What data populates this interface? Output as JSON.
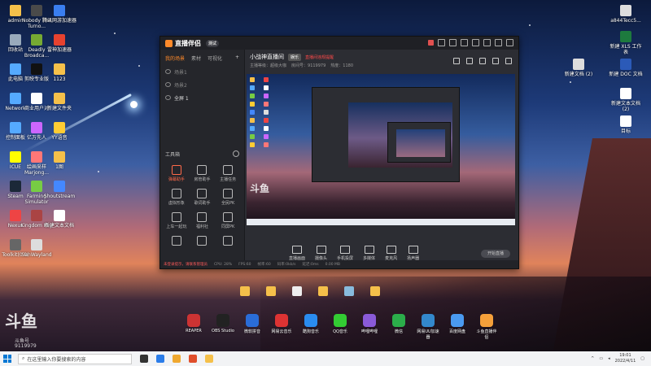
{
  "colors": {
    "accent": "#ff8a2a",
    "warning": "#ff4a4a"
  },
  "desktop": {
    "left_icons": [
      {
        "label": "admin",
        "color": "#f5c04a"
      },
      {
        "label": "Nobody The Turno...",
        "color": "#4a4a4a"
      },
      {
        "label": "腾讯网游加速器",
        "color": "#3a7ef0"
      },
      {
        "label": "回收站",
        "color": "#9ab"
      },
      {
        "label": "Deadly Broadca...",
        "color": "#7a3"
      },
      {
        "label": "雷神加速器",
        "color": "#e7422f"
      },
      {
        "label": "此电脑",
        "color": "#5af"
      },
      {
        "label": "剪映专业版",
        "color": "#111"
      },
      {
        "label": "1123",
        "color": "#f5c04a"
      },
      {
        "label": "Network",
        "color": "#5af"
      },
      {
        "label": "商业用户对",
        "color": "#fff"
      },
      {
        "label": "新建文件夹",
        "color": "#f5c04a"
      },
      {
        "label": "控制面板",
        "color": "#5af"
      },
      {
        "label": "亿万先人",
        "color": "#c6f"
      },
      {
        "label": "YY语音",
        "color": "#fc3"
      },
      {
        "label": "ICUE",
        "color": "#ff0"
      },
      {
        "label": "绘画采样 Marjong...",
        "color": "#f77"
      },
      {
        "label": "1图",
        "color": "#f5c04a"
      },
      {
        "label": "Steam",
        "color": "#1b2838"
      },
      {
        "label": "Farming Simulator",
        "color": "#7c4"
      },
      {
        "label": "Shoutstream",
        "color": "#48f"
      },
      {
        "label": "Nexus",
        "color": "#e44"
      },
      {
        "label": "Kingdom Key",
        "color": "#a44"
      },
      {
        "label": "新建文本文档",
        "color": "#fff"
      },
      {
        "label": "Toolkit(0.9)",
        "color": "#666"
      },
      {
        "label": "SunWayland",
        "color": "#ddd"
      }
    ],
    "right_icons": [
      {
        "label": "a844Tecc5...",
        "color": "#ddd"
      },
      {
        "label": "新建 XLS 工作表",
        "color": "#1d7a3e"
      },
      {
        "label": "新建文档 (2)",
        "color": "#ddd"
      },
      {
        "label": "新建 DOC 文档",
        "color": "#2b5ab8"
      },
      {
        "label": "新建文本文档 (2)",
        "color": "#fff"
      },
      {
        "label": "目标",
        "color": "#fff"
      }
    ],
    "dock": [
      {
        "label": "REAPER",
        "color": "#c33"
      },
      {
        "label": "OBS Studio",
        "color": "#222"
      },
      {
        "label": "微软拼音",
        "color": "#2a6dd8"
      },
      {
        "label": "网易云音乐",
        "color": "#d33"
      },
      {
        "label": "酷狗音乐",
        "color": "#2a8cf0"
      },
      {
        "label": "QQ音乐",
        "color": "#3c3"
      },
      {
        "label": "哔哩哔哩",
        "color": "#8a5ad8"
      },
      {
        "label": "微信",
        "color": "#2bad4a"
      },
      {
        "label": "网易UU加速器",
        "color": "#38c"
      },
      {
        "label": "百度网盘",
        "color": "#4a9af0"
      },
      {
        "label": "斗鱼直播伴侣",
        "color": "#f5a03a"
      }
    ],
    "float_icons": [
      {
        "label": "",
        "color": "#f5c04a"
      },
      {
        "label": "",
        "color": "#f5c04a"
      },
      {
        "label": "",
        "color": "#eee"
      },
      {
        "label": "",
        "color": "#f5c04a"
      },
      {
        "label": "",
        "color": "#8bd"
      },
      {
        "label": "",
        "color": "#f5c04a"
      }
    ],
    "watermark": {
      "title": "斗鱼",
      "sub": "斗鱼号",
      "number": "9119979"
    }
  },
  "window": {
    "app_name": "直播伴侣",
    "version_badge": "测试",
    "title_controls": [
      "avatar",
      "gift-icon",
      "shield-icon",
      "bell-icon",
      "settings-icon",
      "minimize-icon",
      "maximize-icon",
      "close-icon"
    ],
    "left_tabs": [
      "我的场景",
      "素材",
      "可视化"
    ],
    "scenes": [
      {
        "label": "场景1"
      },
      {
        "label": "场景2"
      },
      {
        "label": "全屏 1"
      }
    ],
    "tools_header": "工具箱",
    "tools": [
      {
        "label": "弹幕助手",
        "red": true
      },
      {
        "label": "房管助手",
        "red": false
      },
      {
        "label": "主播任务",
        "red": false
      },
      {
        "label": "虚拟形象",
        "red": false
      },
      {
        "label": "歌词助手",
        "red": false
      },
      {
        "label": "全民PK",
        "red": false
      },
      {
        "label": "上车一起玩",
        "red": false
      },
      {
        "label": "福利社",
        "red": false
      },
      {
        "label": "同屏PK",
        "red": false
      },
      {
        "label": "",
        "red": false
      },
      {
        "label": "",
        "red": false
      },
      {
        "label": "",
        "red": false
      }
    ],
    "room_title": "小战神直播间",
    "room_badge": "娱乐",
    "room_alert": "直播间违规提醒",
    "room_meta": [
      "主播等级：超级大咖",
      "房间号：9119979",
      "热度：1180"
    ],
    "bottom_buttons": [
      "直播画面",
      "摄像头",
      "手机投屏",
      "多媒体",
      "麦克风",
      "扬声器"
    ],
    "start_label": "开始直播",
    "status": [
      {
        "text": "未登录提示，请联系管理员",
        "warn": true
      },
      {
        "text": "CPU: 28%"
      },
      {
        "text": "FPS:60"
      },
      {
        "text": "帧率:60"
      },
      {
        "text": "码率:0kb/s"
      },
      {
        "text": "延迟:0ms"
      },
      {
        "text": "0.00 MB"
      }
    ],
    "preview_watermark": "斗鱼"
  },
  "taskbar": {
    "search_placeholder": "在这里输入你要搜索的内容",
    "apps": [
      {
        "color": "#333"
      },
      {
        "color": "#2b7de9"
      },
      {
        "color": "#f0a830"
      },
      {
        "color": "#e04e2b"
      },
      {
        "color": "#f5c04a"
      }
    ],
    "time": "19:01",
    "date": "2022/4/11"
  }
}
